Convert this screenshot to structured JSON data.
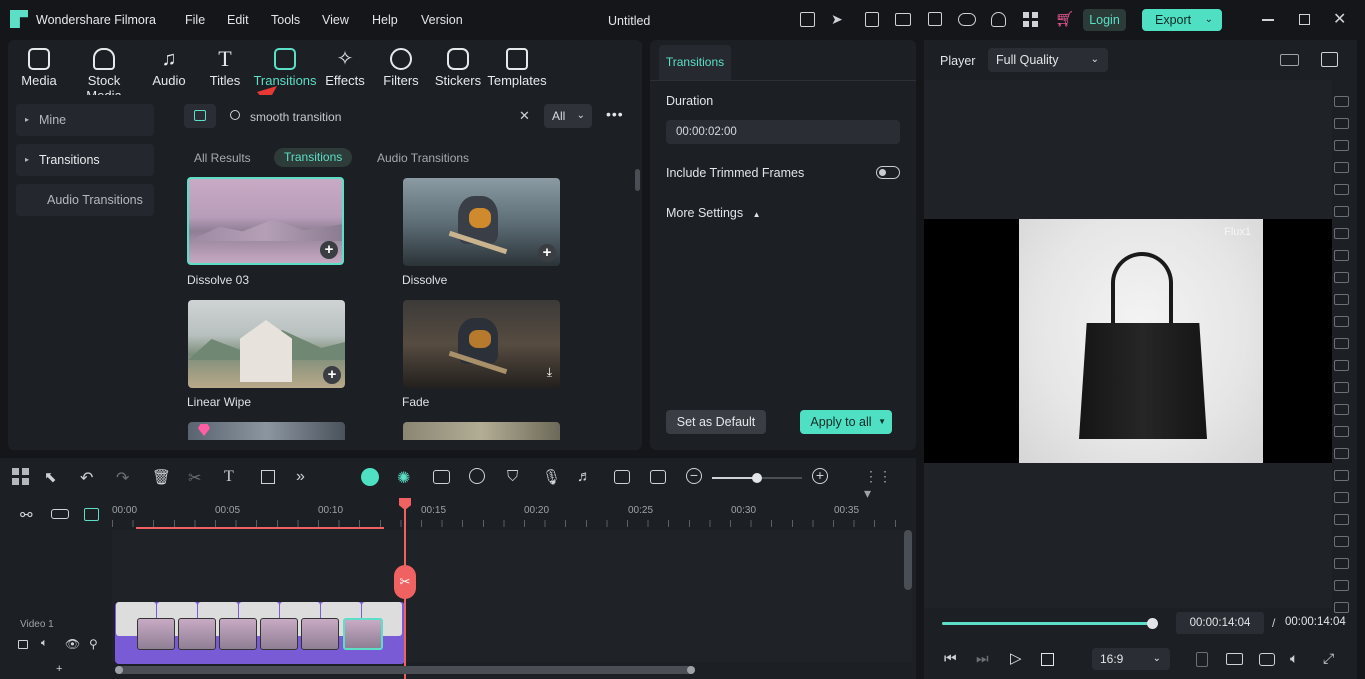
{
  "app": {
    "name": "Wondershare Filmora",
    "project": "Untitled",
    "login": "Login",
    "export": "Export"
  },
  "menu": [
    "File",
    "Edit",
    "Tools",
    "View",
    "Help",
    "Version"
  ],
  "tools": [
    {
      "label": "Media",
      "icon": "media-icon"
    },
    {
      "label": "Stock Media",
      "icon": "stock-media-icon"
    },
    {
      "label": "Audio",
      "icon": "audio-icon"
    },
    {
      "label": "Titles",
      "icon": "titles-icon"
    },
    {
      "label": "Transitions",
      "icon": "transitions-icon",
      "active": true
    },
    {
      "label": "Effects",
      "icon": "effects-icon"
    },
    {
      "label": "Filters",
      "icon": "filters-icon"
    },
    {
      "label": "Stickers",
      "icon": "stickers-icon"
    },
    {
      "label": "Templates",
      "icon": "templates-icon"
    }
  ],
  "sidebar": {
    "items": [
      "Mine",
      "Transitions",
      "Audio Transitions"
    ]
  },
  "search": {
    "value": "smooth transition",
    "filter": "All"
  },
  "result_tabs": [
    "All Results",
    "Transitions",
    "Audio Transitions"
  ],
  "results": [
    {
      "name": "Dissolve 03"
    },
    {
      "name": "Dissolve"
    },
    {
      "name": "Linear Wipe"
    },
    {
      "name": "Fade"
    }
  ],
  "properties": {
    "tab": "Transitions",
    "duration_label": "Duration",
    "duration": "00:00:02:00",
    "trimmed_label": "Include Trimmed Frames",
    "trimmed_on": false,
    "more_settings": "More Settings",
    "set_default": "Set as Default",
    "apply_all": "Apply to all"
  },
  "player": {
    "label": "Player",
    "quality": "Full Quality",
    "watermark": "Flux1",
    "current": "00:00:14:04",
    "separator": "/",
    "total": "00:00:14:04",
    "aspect": "16:9",
    "progress": 1.0
  },
  "timeline": {
    "ruler": [
      "00:00",
      "00:05",
      "00:10",
      "00:15",
      "00:20",
      "00:25",
      "00:30",
      "00:35"
    ],
    "track_label": "Video 1"
  },
  "colors": {
    "accent": "#5cdfc6",
    "playhead": "#f06262",
    "export_bg": "#4fe0c3",
    "bg": "#1c1f24"
  }
}
